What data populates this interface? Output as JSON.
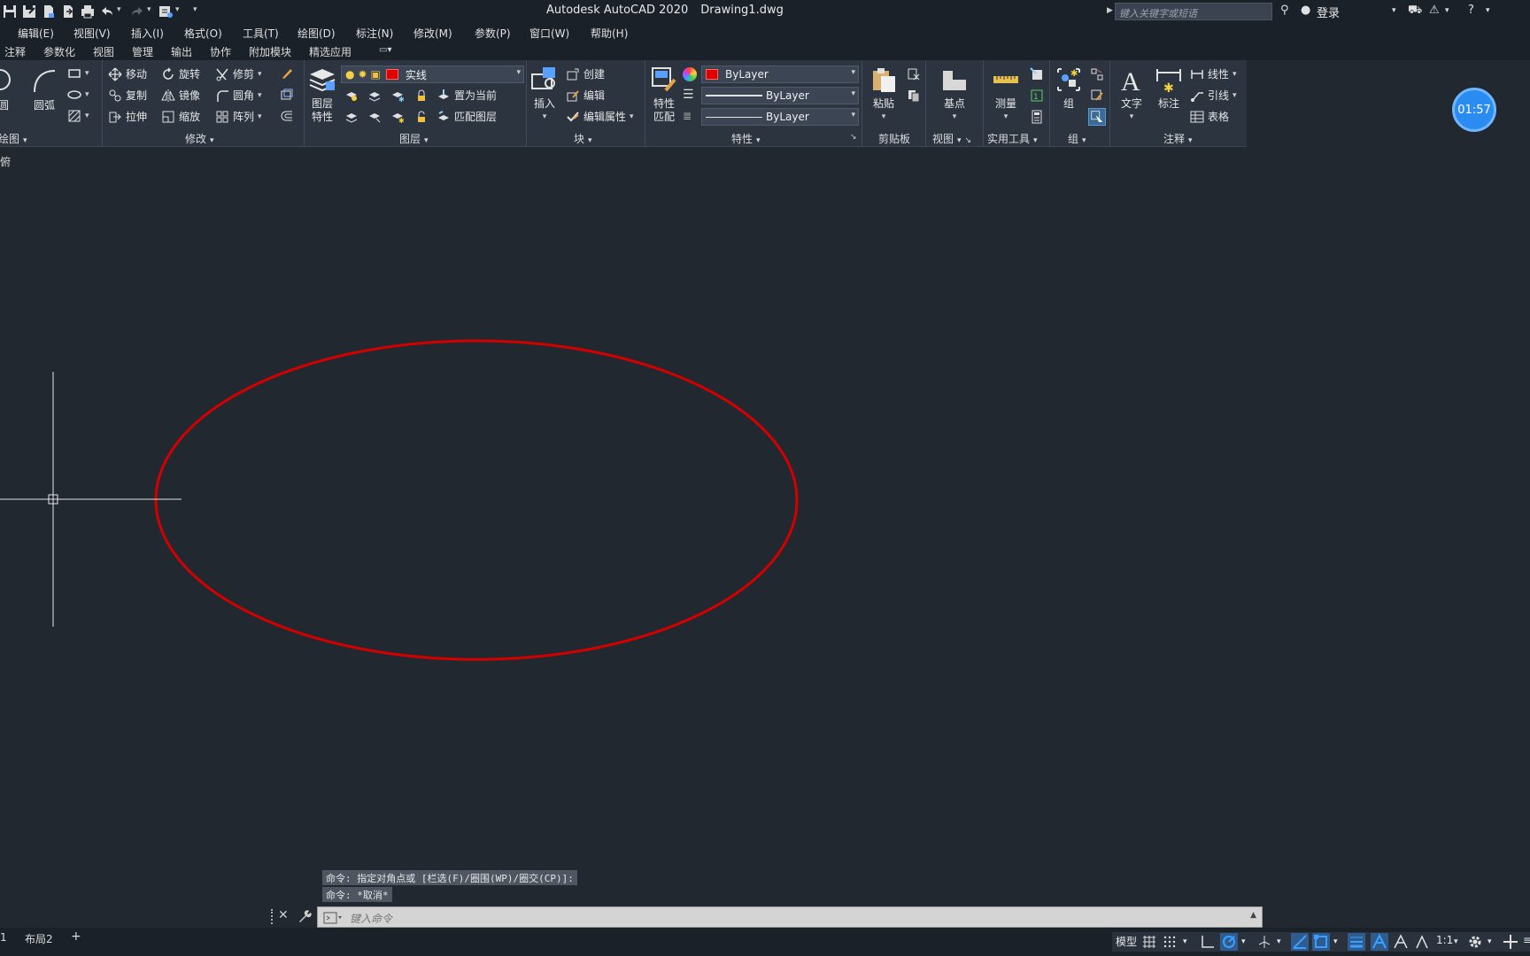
{
  "titlebar": {
    "app_title": "Autodesk AutoCAD 2020",
    "document": "Drawing1.dwg",
    "search_placeholder": "键入关键字或短语",
    "login_label": "登录"
  },
  "menu": [
    "编辑(E)",
    "视图(V)",
    "插入(I)",
    "格式(O)",
    "工具(T)",
    "绘图(D)",
    "标注(N)",
    "修改(M)",
    "参数(P)",
    "窗口(W)",
    "帮助(H)"
  ],
  "ribbon_tabs": [
    "注释",
    "参数化",
    "视图",
    "管理",
    "输出",
    "协作",
    "附加模块",
    "精选应用"
  ],
  "ribbon": {
    "draw": {
      "circle": "圆",
      "arc": "圆弧",
      "panel_title": "绘图"
    },
    "modify": {
      "move": "移动",
      "rotate": "旋转",
      "trim": "修剪",
      "copy": "复制",
      "mirror": "镜像",
      "fillet": "圆角",
      "stretch": "拉伸",
      "scale": "缩放",
      "array": "阵列",
      "panel_title": "修改"
    },
    "layers": {
      "layer_properties": "图层\n特性",
      "layer_properties_l1": "图层",
      "layer_properties_l2": "特性",
      "current_layer": "实线",
      "set_current": "置为当前",
      "match_layer": "匹配图层",
      "panel_title": "图层"
    },
    "block": {
      "insert": "插入",
      "create": "创建",
      "edit": "编辑",
      "edit_attributes": "编辑属性",
      "panel_title": "块"
    },
    "properties": {
      "match_l1": "特性",
      "match_l2": "匹配",
      "color": "ByLayer",
      "lineweight": "ByLayer",
      "linetype": "ByLayer",
      "panel_title": "特性"
    },
    "clipboard": {
      "paste": "粘贴",
      "panel_title": "剪贴板"
    },
    "view": {
      "base_point": "基点",
      "panel_title": "视图"
    },
    "utilities": {
      "measure": "测量",
      "panel_title": "实用工具"
    },
    "groups": {
      "group": "组",
      "panel_title": "组"
    },
    "annotation": {
      "text": "文字",
      "dimension": "标注",
      "linear": "线性",
      "leader": "引线",
      "table": "表格",
      "panel_title": "注释"
    }
  },
  "clock": "01:57",
  "viewport_label": "俯",
  "drawing": {
    "ellipse_color": "#d40000",
    "crosshair_color": "#e8e8e8"
  },
  "command_history": [
    "命令: 指定对角点或 [栏选(F)/圈围(WP)/圈交(CP)]:",
    "命令: *取消*"
  ],
  "command_input_placeholder": "键入命令",
  "layout_tabs": [
    "1",
    "布局2",
    "+"
  ],
  "status": {
    "model": "模型",
    "scale": "1:1"
  }
}
